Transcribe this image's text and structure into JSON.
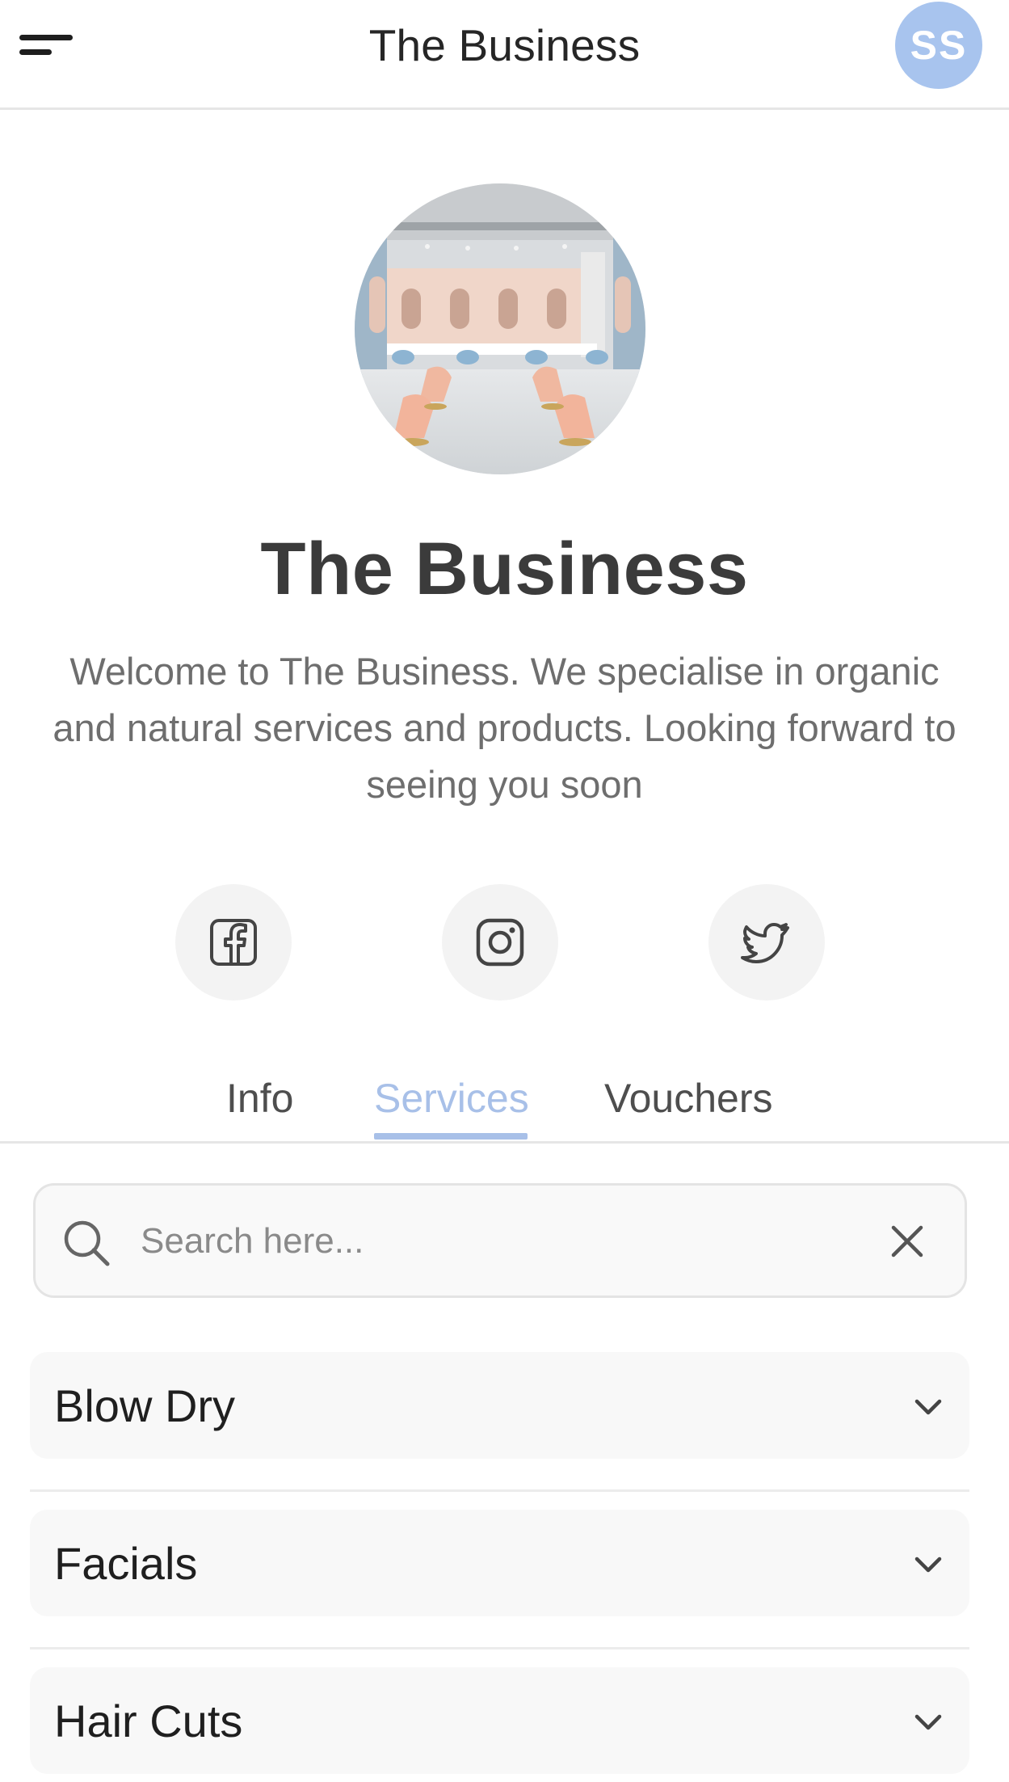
{
  "header": {
    "title": "The Business",
    "avatar_initials": "SS",
    "avatar_color": "#a8c4ee"
  },
  "profile": {
    "name": "The Business",
    "description": "Welcome to The Business. We specialise in organic and natural services and products. Looking forward to seeing you soon"
  },
  "social": [
    {
      "icon": "facebook-icon"
    },
    {
      "icon": "instagram-icon"
    },
    {
      "icon": "twitter-icon"
    }
  ],
  "tabs": [
    {
      "label": "Info",
      "active": false
    },
    {
      "label": "Services",
      "active": true
    },
    {
      "label": "Vouchers",
      "active": false
    }
  ],
  "search": {
    "placeholder": "Search here...",
    "value": ""
  },
  "categories": [
    {
      "label": "Blow Dry"
    },
    {
      "label": "Facials"
    },
    {
      "label": "Hair Cuts"
    }
  ],
  "colors": {
    "accent": "#a8c0e8",
    "text_dark": "#2b2b2b",
    "text_muted": "#6e6e6e"
  }
}
